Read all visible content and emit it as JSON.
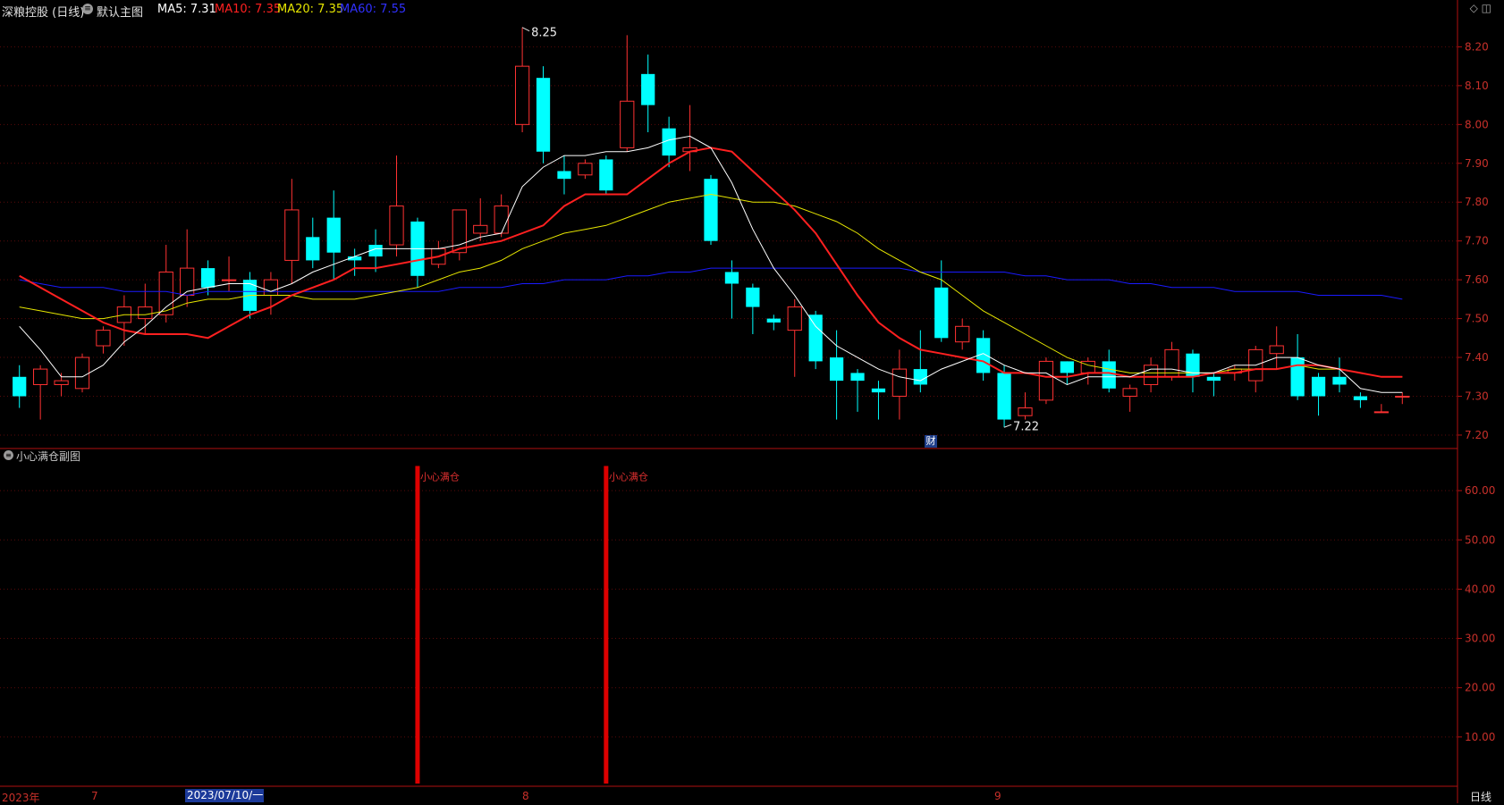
{
  "header": {
    "title": "深粮控股 (日线)",
    "main_chart": "默认主图",
    "ma5": "MA5: 7.31",
    "ma10": "MA10: 7.35",
    "ma20": "MA20: 7.35",
    "ma60": "MA60: 7.55"
  },
  "sub_chart": {
    "title": "小心满仓副图",
    "bar_label": "小心满仓"
  },
  "bottom_axis": {
    "year": "2023年",
    "m7": "7",
    "selected_date": "2023/07/10/一",
    "m8": "8",
    "m9": "9",
    "period_button": "日线"
  },
  "finance_badge": "财",
  "colors": {
    "up": "#ff3232",
    "down": "#00ffff",
    "ma5": "#ffffff",
    "ma10": "#ff2020",
    "ma20": "#e6e600",
    "ma60": "#1a1aff",
    "signal": "#dd0000",
    "axis": "#b01010"
  },
  "chart_data": [
    {
      "type": "candlestick",
      "title": "",
      "ylim": [
        7.17,
        8.27
      ],
      "yticks": [
        "8.20",
        "8.10",
        "8.00",
        "7.90",
        "7.80",
        "7.70",
        "7.60",
        "7.50",
        "7.40",
        "7.30",
        "7.20"
      ],
      "annotations": [
        {
          "text": "8.25",
          "index": 24
        },
        {
          "text": "7.22",
          "index": 47
        }
      ],
      "candles": [
        [
          7.35,
          7.3,
          7.38,
          7.27
        ],
        [
          7.33,
          7.37,
          7.38,
          7.24
        ],
        [
          7.33,
          7.34,
          7.36,
          7.3
        ],
        [
          7.32,
          7.4,
          7.41,
          7.31
        ],
        [
          7.43,
          7.47,
          7.48,
          7.41
        ],
        [
          7.49,
          7.53,
          7.56,
          7.43
        ],
        [
          7.5,
          7.53,
          7.59,
          7.46
        ],
        [
          7.51,
          7.62,
          7.69,
          7.49
        ],
        [
          7.56,
          7.63,
          7.73,
          7.53
        ],
        [
          7.63,
          7.58,
          7.65,
          7.56
        ],
        [
          7.6,
          7.6,
          7.66,
          7.57
        ],
        [
          7.6,
          7.52,
          7.62,
          7.5
        ],
        [
          7.56,
          7.6,
          7.62,
          7.51
        ],
        [
          7.65,
          7.78,
          7.86,
          7.59
        ],
        [
          7.71,
          7.65,
          7.76,
          7.63
        ],
        [
          7.76,
          7.67,
          7.83,
          7.6
        ],
        [
          7.66,
          7.65,
          7.68,
          7.61
        ],
        [
          7.69,
          7.66,
          7.73,
          7.62
        ],
        [
          7.69,
          7.79,
          7.92,
          7.66
        ],
        [
          7.75,
          7.61,
          7.76,
          7.58
        ],
        [
          7.64,
          7.68,
          7.7,
          7.63
        ],
        [
          7.67,
          7.78,
          7.78,
          7.65
        ],
        [
          7.72,
          7.74,
          7.81,
          7.7
        ],
        [
          7.72,
          7.79,
          7.82,
          7.71
        ],
        [
          8.0,
          8.15,
          8.25,
          7.98
        ],
        [
          8.12,
          7.93,
          8.15,
          7.9
        ],
        [
          7.88,
          7.86,
          7.92,
          7.82
        ],
        [
          7.87,
          7.9,
          7.91,
          7.86
        ],
        [
          7.91,
          7.83,
          7.92,
          7.82
        ],
        [
          7.94,
          8.06,
          8.23,
          7.93
        ],
        [
          8.13,
          8.05,
          8.18,
          7.98
        ],
        [
          7.99,
          7.92,
          8.02,
          7.89
        ],
        [
          7.93,
          7.94,
          8.05,
          7.88
        ],
        [
          7.86,
          7.7,
          7.87,
          7.69
        ],
        [
          7.62,
          7.59,
          7.65,
          7.5
        ],
        [
          7.58,
          7.53,
          7.59,
          7.46
        ],
        [
          7.5,
          7.49,
          7.51,
          7.47
        ],
        [
          7.47,
          7.53,
          7.55,
          7.35
        ],
        [
          7.51,
          7.39,
          7.52,
          7.37
        ],
        [
          7.4,
          7.34,
          7.47,
          7.24
        ],
        [
          7.36,
          7.34,
          7.37,
          7.26
        ],
        [
          7.32,
          7.31,
          7.34,
          7.24
        ],
        [
          7.3,
          7.37,
          7.42,
          7.24
        ],
        [
          7.37,
          7.33,
          7.47,
          7.31
        ],
        [
          7.58,
          7.45,
          7.65,
          7.44
        ],
        [
          7.44,
          7.48,
          7.5,
          7.42
        ],
        [
          7.45,
          7.36,
          7.47,
          7.34
        ],
        [
          7.36,
          7.24,
          7.38,
          7.22
        ],
        [
          7.25,
          7.27,
          7.31,
          7.24
        ],
        [
          7.29,
          7.39,
          7.4,
          7.28
        ],
        [
          7.39,
          7.36,
          7.39,
          7.33
        ],
        [
          7.36,
          7.39,
          7.4,
          7.33
        ],
        [
          7.39,
          7.32,
          7.42,
          7.31
        ],
        [
          7.3,
          7.32,
          7.33,
          7.26
        ],
        [
          7.33,
          7.38,
          7.4,
          7.31
        ],
        [
          7.35,
          7.42,
          7.44,
          7.34
        ],
        [
          7.41,
          7.35,
          7.42,
          7.31
        ],
        [
          7.35,
          7.34,
          7.36,
          7.3
        ],
        [
          7.36,
          7.37,
          7.38,
          7.34
        ],
        [
          7.34,
          7.42,
          7.43,
          7.31
        ],
        [
          7.41,
          7.43,
          7.48,
          7.37
        ],
        [
          7.4,
          7.3,
          7.46,
          7.29
        ],
        [
          7.35,
          7.3,
          7.36,
          7.25
        ],
        [
          7.35,
          7.33,
          7.4,
          7.31
        ],
        [
          7.3,
          7.29,
          7.31,
          7.27
        ],
        [
          7.26,
          7.26,
          7.28,
          7.26
        ],
        [
          7.3,
          7.3,
          7.31,
          7.28
        ]
      ],
      "ma5": [
        7.48,
        7.42,
        7.35,
        7.35,
        7.38,
        7.44,
        7.48,
        7.53,
        7.57,
        7.58,
        7.59,
        7.59,
        7.57,
        7.59,
        7.62,
        7.64,
        7.66,
        7.68,
        7.68,
        7.68,
        7.68,
        7.69,
        7.71,
        7.72,
        7.84,
        7.89,
        7.92,
        7.92,
        7.93,
        7.93,
        7.94,
        7.96,
        7.97,
        7.94,
        7.85,
        7.73,
        7.63,
        7.56,
        7.48,
        7.43,
        7.4,
        7.37,
        7.35,
        7.34,
        7.37,
        7.39,
        7.41,
        7.38,
        7.36,
        7.36,
        7.33,
        7.35,
        7.35,
        7.35,
        7.37,
        7.37,
        7.36,
        7.36,
        7.38,
        7.38,
        7.4,
        7.4,
        7.38,
        7.37,
        7.32,
        7.31,
        7.31
      ],
      "ma10": [
        7.61,
        7.58,
        7.55,
        7.52,
        7.49,
        7.47,
        7.46,
        7.46,
        7.46,
        7.45,
        7.48,
        7.51,
        7.53,
        7.56,
        7.58,
        7.6,
        7.63,
        7.63,
        7.64,
        7.65,
        7.66,
        7.68,
        7.69,
        7.7,
        7.72,
        7.74,
        7.79,
        7.82,
        7.82,
        7.82,
        7.86,
        7.9,
        7.93,
        7.94,
        7.93,
        7.88,
        7.83,
        7.78,
        7.72,
        7.64,
        7.56,
        7.49,
        7.45,
        7.42,
        7.41,
        7.4,
        7.39,
        7.36,
        7.36,
        7.35,
        7.35,
        7.36,
        7.36,
        7.35,
        7.35,
        7.35,
        7.35,
        7.36,
        7.36,
        7.37,
        7.37,
        7.38,
        7.38,
        7.37,
        7.36,
        7.35,
        7.35
      ],
      "ma20": [
        7.53,
        7.52,
        7.51,
        7.5,
        7.5,
        7.51,
        7.51,
        7.52,
        7.54,
        7.55,
        7.55,
        7.56,
        7.56,
        7.56,
        7.55,
        7.55,
        7.55,
        7.56,
        7.57,
        7.58,
        7.6,
        7.62,
        7.63,
        7.65,
        7.68,
        7.7,
        7.72,
        7.73,
        7.74,
        7.76,
        7.78,
        7.8,
        7.81,
        7.82,
        7.81,
        7.8,
        7.8,
        7.79,
        7.77,
        7.75,
        7.72,
        7.68,
        7.65,
        7.62,
        7.6,
        7.56,
        7.52,
        7.49,
        7.46,
        7.43,
        7.4,
        7.38,
        7.37,
        7.36,
        7.36,
        7.36,
        7.36,
        7.36,
        7.37,
        7.37,
        7.37,
        7.38,
        7.37,
        7.37,
        7.36,
        7.35,
        7.35
      ],
      "ma60": [
        7.6,
        7.59,
        7.58,
        7.58,
        7.58,
        7.57,
        7.57,
        7.57,
        7.56,
        7.57,
        7.57,
        7.57,
        7.57,
        7.57,
        7.57,
        7.57,
        7.57,
        7.57,
        7.57,
        7.57,
        7.57,
        7.58,
        7.58,
        7.58,
        7.59,
        7.59,
        7.6,
        7.6,
        7.6,
        7.61,
        7.61,
        7.62,
        7.62,
        7.63,
        7.63,
        7.63,
        7.63,
        7.63,
        7.63,
        7.63,
        7.63,
        7.63,
        7.63,
        7.62,
        7.62,
        7.62,
        7.62,
        7.62,
        7.61,
        7.61,
        7.6,
        7.6,
        7.6,
        7.59,
        7.59,
        7.58,
        7.58,
        7.58,
        7.57,
        7.57,
        7.57,
        7.57,
        7.56,
        7.56,
        7.56,
        7.56,
        7.55
      ]
    },
    {
      "type": "bar",
      "title": "小心满仓副图",
      "ylim": [
        0,
        68
      ],
      "yticks": [
        "60.00",
        "50.00",
        "40.00",
        "30.00",
        "20.00",
        "10.00"
      ],
      "signals": [
        {
          "index": 19,
          "value": 65,
          "label": "小心满仓"
        },
        {
          "index": 28,
          "value": 65,
          "label": "小心满仓"
        }
      ]
    }
  ]
}
